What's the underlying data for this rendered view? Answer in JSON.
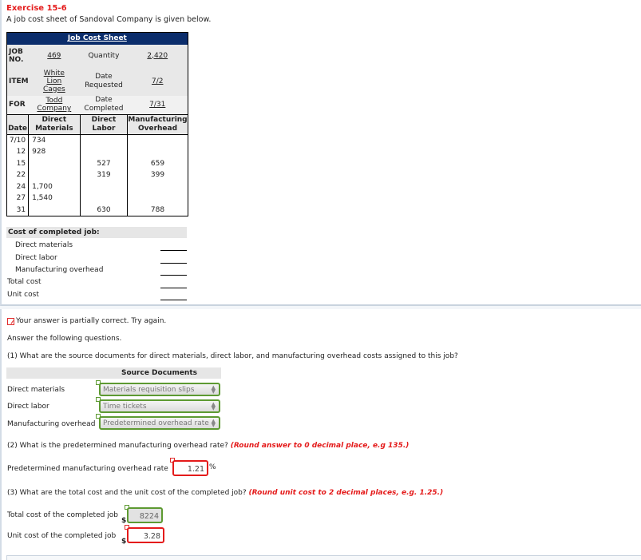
{
  "exercise": {
    "title": "Exercise 15-6",
    "intro": "A job cost sheet of Sandoval Company is given below."
  },
  "job_cost_sheet": {
    "title": "Job Cost Sheet",
    "job_no_label": "JOB NO.",
    "job_no": "469",
    "quantity_label": "Quantity",
    "quantity": "2,420",
    "item_label": "ITEM",
    "item": "White Lion Cages",
    "date_requested_label": "Date Requested",
    "date_requested": "7/2",
    "for_label": "FOR",
    "for": "Todd Company",
    "date_completed_label": "Date Completed",
    "date_completed": "7/31",
    "columns": [
      "Date",
      "Direct Materials",
      "Direct Labor",
      "Manufacturing Overhead"
    ],
    "rows": [
      {
        "date": "7/10",
        "dm": "734",
        "dl": "",
        "moh": ""
      },
      {
        "date": "12",
        "dm": "928",
        "dl": "",
        "moh": ""
      },
      {
        "date": "15",
        "dm": "",
        "dl": "527",
        "moh": "659"
      },
      {
        "date": "22",
        "dm": "",
        "dl": "319",
        "moh": "399"
      },
      {
        "date": "24",
        "dm": "1,700",
        "dl": "",
        "moh": ""
      },
      {
        "date": "27",
        "dm": "1,540",
        "dl": "",
        "moh": ""
      },
      {
        "date": "31",
        "dm": "",
        "dl": "630",
        "moh": "788"
      }
    ]
  },
  "cost_of_completed_job": {
    "heading": "Cost of completed job:",
    "lines": [
      "Direct materials",
      "Direct labor",
      "Manufacturing overhead",
      "Total cost",
      "Unit cost"
    ]
  },
  "feedback": {
    "status": "Your answer is partially correct.  Try again.",
    "instruction": "Answer the following questions."
  },
  "q1": {
    "question": "(1) What are the source documents for direct materials, direct labor, and manufacturing overhead costs assigned to this job?",
    "table_heading": "Source Documents",
    "rows": [
      {
        "label": "Direct materials",
        "selected": "Materials requisition slips",
        "status": "correct"
      },
      {
        "label": "Direct labor",
        "selected": "Time tickets",
        "status": "correct"
      },
      {
        "label": "Manufacturing overhead",
        "selected": "Predetermined overhead rate",
        "status": "correct"
      }
    ]
  },
  "q2": {
    "question": "(2) What is the predetermined manufacturing overhead rate?",
    "note": "(Round answer to 0 decimal place, e.g 135.)",
    "label": "Predetermined manufacturing overhead rate",
    "value": "1.21",
    "unit": "%",
    "status": "incorrect"
  },
  "q3": {
    "question": "(3) What are the total cost and the unit cost of the completed job?",
    "note": "(Round unit cost to 2 decimal places, e.g. 1.25.)",
    "total_label": "Total cost of the completed job",
    "total_value": "8224",
    "total_status": "correct",
    "unit_label": "Unit cost of the completed job",
    "unit_value": "3.28",
    "unit_status": "incorrect",
    "currency": "$"
  },
  "colors": {
    "error": "#e41b1b",
    "correct": "#5d9a32",
    "header_navy": "#0b2d6b"
  }
}
